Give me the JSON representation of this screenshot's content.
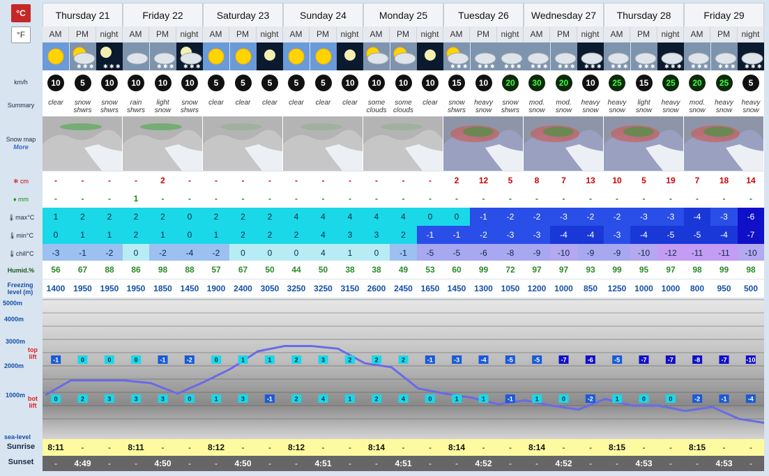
{
  "units": {
    "celsius": "°C",
    "fahrenheit": "°F"
  },
  "labels": {
    "wind": "km/h",
    "summary": "Summary",
    "snowmap": "Snow map",
    "more": "More",
    "snow": "cm",
    "rain": "mm",
    "max": "max°C",
    "min": "min°C",
    "chill": "chill°C",
    "humid": "Humid.%",
    "freezing": "Freezing level (m)",
    "alt5000": "5000m",
    "alt4000": "4000m",
    "alt3000": "3000m",
    "alt2000": "2000m",
    "alt1000": "1000m",
    "sealevel": "sea-level",
    "toplift": "top lift",
    "botlift": "bot lift",
    "sunrise": "Sunrise",
    "sunset": "Sunset"
  },
  "days": [
    "Thursday 21",
    "Friday 22",
    "Saturday 23",
    "Sunday 24",
    "Monday 25",
    "Tuesday 26",
    "Wednesday 27",
    "Thursday 28",
    "Friday 29"
  ],
  "periods": [
    "AM",
    "PM",
    "night"
  ],
  "icons": [
    "sun",
    "sun-cloud-snow",
    "moon-snow",
    "cloud-rain",
    "cloud-snow",
    "moon-cloud-snow",
    "sun",
    "sun",
    "moon",
    "sun",
    "sun",
    "moon",
    "sun-cloud",
    "sun-cloud",
    "moon",
    "sun-cloud-snow",
    "cloud-snow",
    "cloud-snow",
    "cloud-snow",
    "cloud-snow",
    "cloud-snow-night",
    "cloud-snow",
    "cloud-snow",
    "cloud-snow-night",
    "cloud-snow",
    "cloud-snow",
    "cloud-snow-night"
  ],
  "wind": [
    10,
    5,
    10,
    10,
    10,
    10,
    5,
    5,
    5,
    5,
    5,
    10,
    10,
    10,
    10,
    15,
    10,
    20,
    30,
    20,
    10,
    25,
    15,
    25,
    20,
    25,
    5
  ],
  "summary": [
    "clear",
    "snow shwrs",
    "snow shwrs",
    "rain shwrs",
    "light snow",
    "snow shwrs",
    "clear",
    "clear",
    "clear",
    "clear",
    "clear",
    "clear",
    "some clouds",
    "some clouds",
    "clear",
    "snow shwrs",
    "heavy snow",
    "snow shwrs",
    "mod. snow",
    "mod. snow",
    "heavy snow",
    "heavy snow",
    "light snow",
    "heavy snow",
    "mod. snow",
    "heavy snow",
    "heavy snow"
  ],
  "snow_cm": [
    "-",
    "-",
    "-",
    "-",
    "2",
    "-",
    "-",
    "-",
    "-",
    "-",
    "-",
    "-",
    "-",
    "-",
    "-",
    "2",
    "12",
    "5",
    "8",
    "7",
    "13",
    "10",
    "5",
    "19",
    "7",
    "18",
    "14"
  ],
  "rain_mm": [
    "-",
    "-",
    "-",
    "1",
    "-",
    "-",
    "-",
    "-",
    "-",
    "-",
    "-",
    "-",
    "-",
    "-",
    "-",
    "-",
    "-",
    "-",
    "-",
    "-",
    "-",
    "-",
    "-",
    "-",
    "-",
    "-",
    "-"
  ],
  "max": [
    "1",
    "2",
    "2",
    "2",
    "2",
    "0",
    "2",
    "2",
    "2",
    "4",
    "4",
    "4",
    "4",
    "4",
    "0",
    "0",
    "-1",
    "-2",
    "-2",
    "-3",
    "-2",
    "-2",
    "-3",
    "-3",
    "-4",
    "-3",
    "-6"
  ],
  "min": [
    "0",
    "1",
    "1",
    "2",
    "1",
    "0",
    "1",
    "2",
    "2",
    "2",
    "4",
    "3",
    "3",
    "2",
    "-1",
    "-1",
    "-2",
    "-3",
    "-3",
    "-4",
    "-4",
    "-3",
    "-4",
    "-5",
    "-5",
    "-4",
    "-7"
  ],
  "chill": [
    "-3",
    "-1",
    "-2",
    "0",
    "-2",
    "-4",
    "-2",
    "0",
    "0",
    "0",
    "4",
    "1",
    "0",
    "-1",
    "-5",
    "-5",
    "-6",
    "-8",
    "-9",
    "-10",
    "-9",
    "-9",
    "-10",
    "-12",
    "-11",
    "-11",
    "-10"
  ],
  "humid": [
    "56",
    "67",
    "88",
    "86",
    "98",
    "88",
    "57",
    "67",
    "50",
    "44",
    "50",
    "38",
    "38",
    "49",
    "53",
    "60",
    "99",
    "72",
    "97",
    "97",
    "93",
    "99",
    "95",
    "97",
    "98",
    "99",
    "98"
  ],
  "freezing": [
    "1400",
    "1950",
    "1950",
    "1950",
    "1850",
    "1450",
    "1900",
    "2400",
    "3050",
    "3250",
    "3250",
    "3150",
    "2600",
    "2450",
    "1650",
    "1450",
    "1300",
    "1050",
    "1200",
    "1000",
    "850",
    "1250",
    "1000",
    "1000",
    "800",
    "950",
    "500"
  ],
  "toplift": [
    "-1",
    "0",
    "0",
    "0",
    "-1",
    "-2",
    "0",
    "1",
    "1",
    "2",
    "3",
    "2",
    "2",
    "2",
    "-1",
    "-3",
    "-4",
    "-5",
    "-5",
    "-7",
    "-6",
    "-5",
    "-7",
    "-7",
    "-8",
    "-7",
    "-10"
  ],
  "botlift": [
    "0",
    "2",
    "3",
    "3",
    "3",
    "0",
    "1",
    "3",
    "-1",
    "2",
    "4",
    "1",
    "2",
    "4",
    "0",
    "1",
    "1",
    "-1",
    "1",
    "0",
    "-2",
    "1",
    "0",
    "0",
    "-2",
    "-1",
    "-4"
  ],
  "sunrise": [
    "8:11",
    "8:11",
    "8:12",
    "8:12",
    "8:14",
    "8:14",
    "8:14",
    "8:15",
    "8:15"
  ],
  "sunset": [
    "4:49",
    "4:50",
    "4:50",
    "4:51",
    "4:51",
    "4:52",
    "4:52",
    "4:53",
    "4:53"
  ],
  "dash": "-",
  "colors": {
    "accent": "#c62828",
    "freezeLine": "#6a6ae8",
    "sunrise": "#fdfaa0",
    "sunset": "#666666"
  }
}
